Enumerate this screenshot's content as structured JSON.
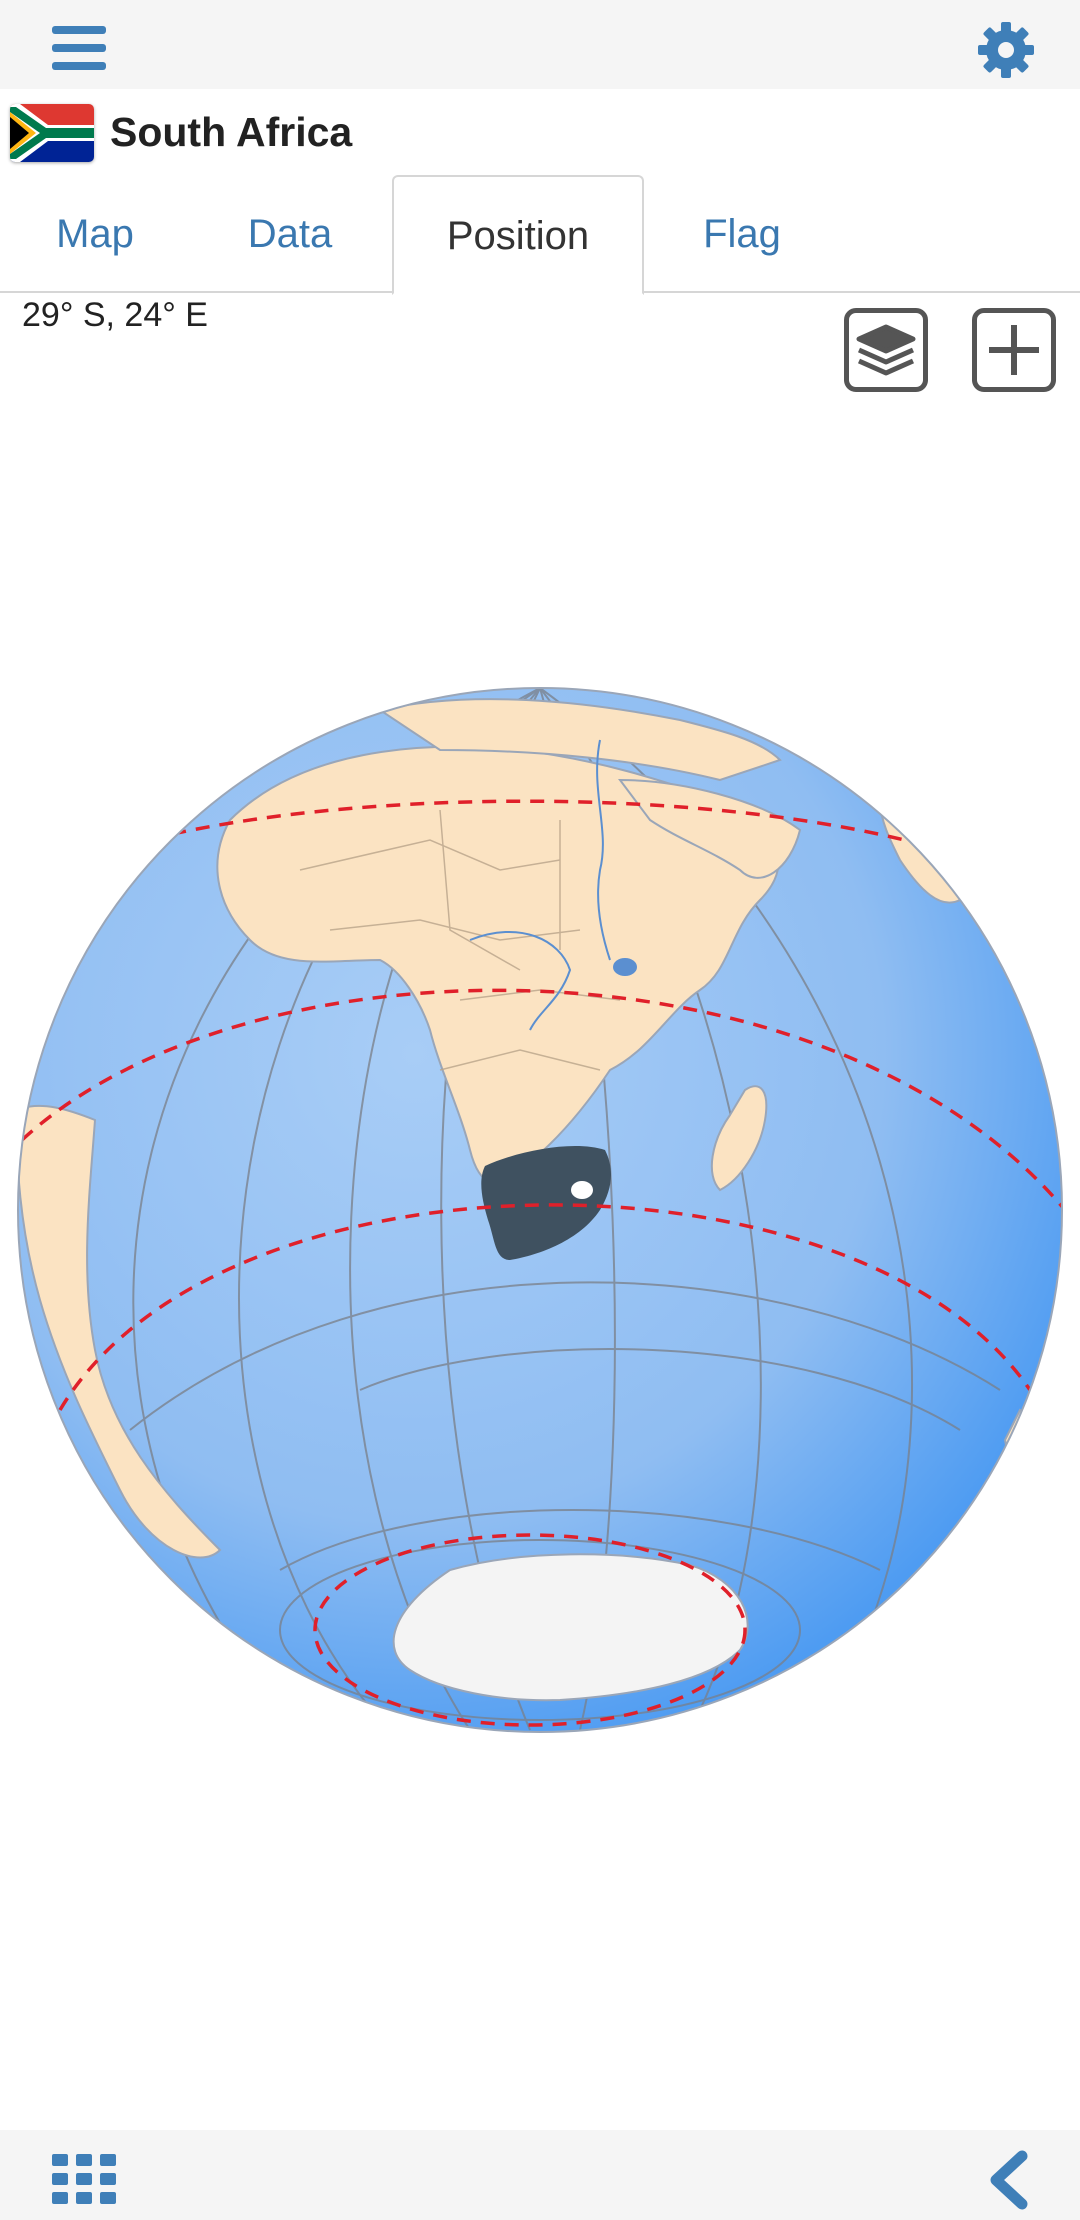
{
  "header": {
    "menu_icon": "hamburger-menu-icon",
    "settings_icon": "gear-icon"
  },
  "country": {
    "name": "South Africa",
    "flag_icon": "south-africa-flag"
  },
  "tabs": [
    {
      "label": "Map",
      "active": false
    },
    {
      "label": "Data",
      "active": false
    },
    {
      "label": "Position",
      "active": true
    },
    {
      "label": "Flag",
      "active": false
    }
  ],
  "position": {
    "coordinates": "29° S, 24° E"
  },
  "toolbar": {
    "layers_icon": "layers-icon",
    "zoom_icon": "plus-icon"
  },
  "globe": {
    "ocean_color": "#8fbdf2",
    "land_color": "#fbe3c2",
    "highlight_color": "#3f5160",
    "antarctica_color": "#f4f4f4",
    "tropic_line_color": "#e0202a"
  },
  "footer": {
    "grid_icon": "app-grid-icon",
    "back_icon": "chevron-left-icon"
  }
}
